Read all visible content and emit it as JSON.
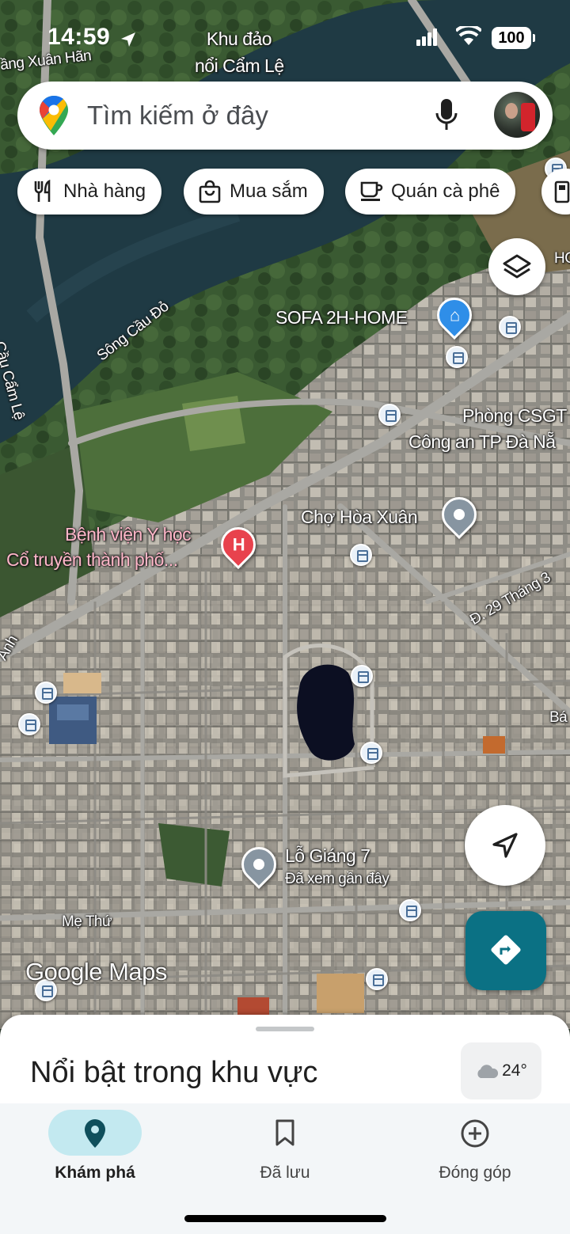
{
  "status_bar": {
    "time": "14:59",
    "battery": "100"
  },
  "search": {
    "placeholder": "Tìm kiếm ở đây"
  },
  "chips": [
    {
      "label": "Nhà hàng",
      "icon": "restaurant-icon"
    },
    {
      "label": "Mua sắm",
      "icon": "shopping-bag-icon"
    },
    {
      "label": "Quán cà phê",
      "icon": "coffee-icon"
    }
  ],
  "map": {
    "labels": {
      "island": "Khu đảo\nnổi Cẩm Lệ",
      "street_top_left": "ầng Xuân Hãn",
      "river": "Sông Cầu Đỏ",
      "bridge": "Cầu Cẩm Lệ",
      "sofa": "SOFA 2H-HOME",
      "police_1": "Phòng CSGT",
      "police_2": "Công an TP Đà Nẵ",
      "edge_right": "HO",
      "market": "Chợ Hòa Xuân",
      "hospital_1": "Bệnh viện Y học",
      "hospital_2": "Cổ truyền thành phố...",
      "road_29": "Đ. 29 Tháng 3",
      "edge_left": "Anh",
      "edge_right_2": "Bá",
      "lo_giang": "Lỗ Giáng 7",
      "recent": "Đã xem gần đây",
      "me_thu": "Mẹ Thứ",
      "watermark": "Google Maps"
    }
  },
  "sheet": {
    "title": "Nổi bật trong khu vực",
    "temperature": "24°"
  },
  "nav": [
    {
      "label": "Khám phá",
      "icon": "explore-pin-icon",
      "active": true
    },
    {
      "label": "Đã lưu",
      "icon": "bookmark-icon",
      "active": false
    },
    {
      "label": "Đóng góp",
      "icon": "add-circle-icon",
      "active": false
    }
  ]
}
